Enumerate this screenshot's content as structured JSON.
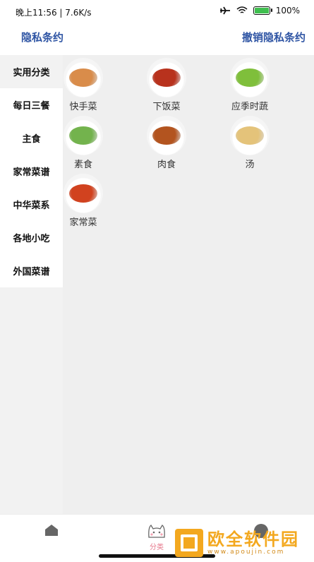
{
  "status": {
    "left_text": "晚上11:56 | 7.6K/s",
    "battery": "100%"
  },
  "nav": {
    "left_link": "隐私条约",
    "right_link": "撤销隐私条约"
  },
  "sidebar": {
    "items": [
      {
        "label": "实用分类"
      },
      {
        "label": "每日三餐"
      },
      {
        "label": "主食"
      },
      {
        "label": "家常菜谱"
      },
      {
        "label": "中华菜系"
      },
      {
        "label": "各地小吃"
      },
      {
        "label": "外国菜谱"
      }
    ]
  },
  "grid": {
    "items": [
      {
        "label": "快手菜",
        "color": "#d98c4a"
      },
      {
        "label": "下饭菜",
        "color": "#b8321d"
      },
      {
        "label": "应季时蔬",
        "color": "#7fbf3b"
      },
      {
        "label": "素食",
        "color": "#73b34d"
      },
      {
        "label": "肉食",
        "color": "#b3541f"
      },
      {
        "label": "汤",
        "color": "#e4c37a"
      },
      {
        "label": "家常菜",
        "color": "#d1421f"
      }
    ]
  },
  "tabs": {
    "category_label": "分类"
  },
  "watermark": {
    "title": "欧全软件园",
    "url": "www.apoujin.com"
  }
}
